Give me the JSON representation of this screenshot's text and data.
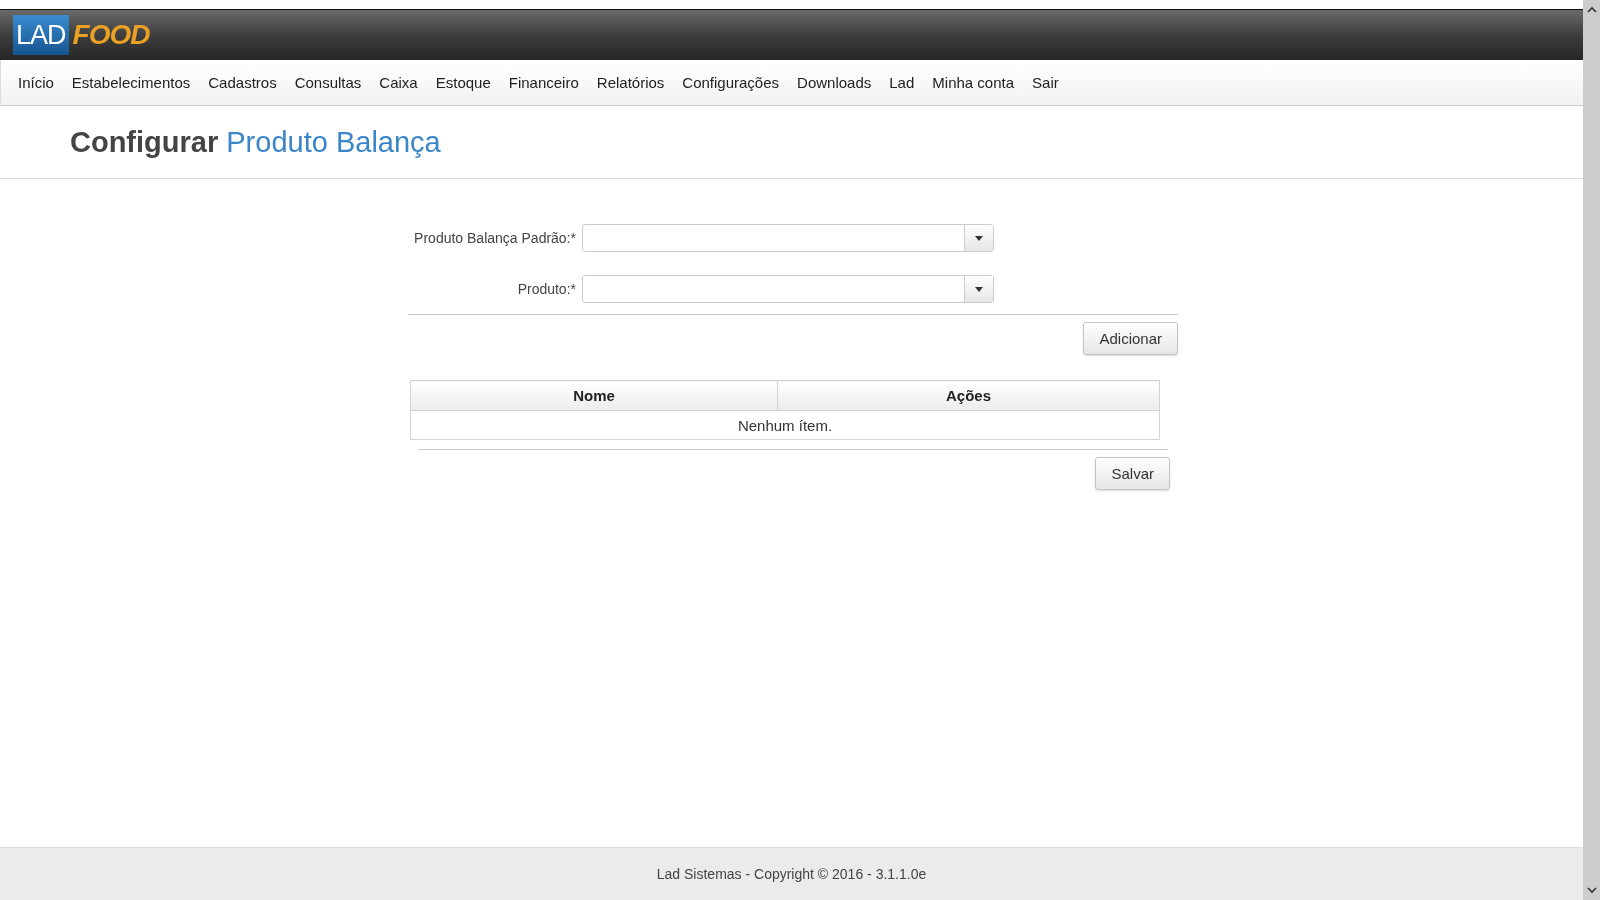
{
  "logo": {
    "first": "LAD",
    "second": "FOOD"
  },
  "nav": [
    "Início",
    "Estabelecimentos",
    "Cadastros",
    "Consultas",
    "Caixa",
    "Estoque",
    "Financeiro",
    "Relatórios",
    "Configurações",
    "Downloads",
    "Lad",
    "Minha conta",
    "Sair"
  ],
  "title": {
    "action": "Configurar",
    "subject": "Produto Balança"
  },
  "form": {
    "fields": [
      {
        "label": "Produto Balança Padrão:*"
      },
      {
        "label": "Produto:*"
      }
    ],
    "add_button": "Adicionar"
  },
  "table": {
    "columns": [
      "Nome",
      "Ações"
    ],
    "empty": "Nenhum ítem."
  },
  "save_button": "Salvar",
  "footer": "Lad Sistemas - Copyright © 2016 - 3.1.1.0e"
}
